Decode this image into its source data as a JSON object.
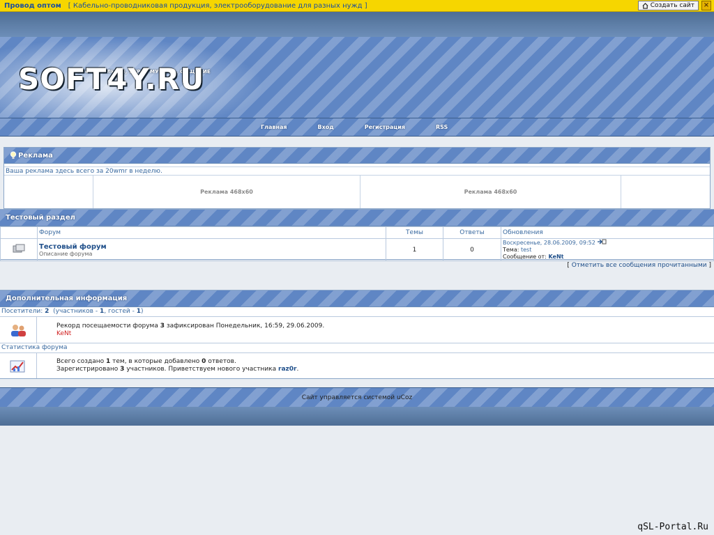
{
  "ad_bar": {
    "title": "Провод оптом",
    "description": "[ Кабельно-проводниковая продукция, электрооборудование для разных нужд ]",
    "create_site_label": "Создать сайт",
    "close_label": "×"
  },
  "header": {
    "logo_text": "SOFT4Y.RU",
    "tagline": "СОФТ, ФИЛЬМЫ, ИГРЫ, МУЗЫКА, ОБЩЕНИЕ"
  },
  "nav": {
    "items": [
      "Главная",
      "Вход",
      "Регистрация",
      "RSS"
    ]
  },
  "ads": {
    "title": "Реклама",
    "note": "Ваша реклама здесь всего за 20wmr в неделю.",
    "banner1": "Реклама 468x60",
    "banner2": "Реклама 468x60"
  },
  "section": {
    "title": "Тестовый раздел",
    "columns": {
      "forum": "Форум",
      "topics": "Темы",
      "replies": "Ответы",
      "updates": "Обновления"
    },
    "forum": {
      "name": "Тестовый форум",
      "description": "Описание форума",
      "topics": "1",
      "replies": "0",
      "last_date": "Воскресенье, 28.06.2009, 09:52",
      "topic_label": "Тема:",
      "topic_name": "test",
      "message_label": "Сообщение от:",
      "message_author": "KeNt"
    }
  },
  "mark_read": {
    "open": "[",
    "label": "Отметить все сообщения прочитанными",
    "close": "]"
  },
  "info": {
    "title": "Дополнительная информация",
    "visitors": {
      "label": "Посетители:",
      "total": "2",
      "members_label": "(участников -",
      "members": "1",
      "guests_label": ", гостей -",
      "guests": "1",
      "close": ")"
    },
    "record": {
      "prefix": "Рекорд посещаемости форума",
      "count": "3",
      "suffix": "зафиксирован Понедельник, 16:59, 29.06.2009.",
      "user": "KeNt"
    },
    "stats_label": "Статистика форума",
    "stats": {
      "l1_a": "Всего создано",
      "topics": "1",
      "l1_b": "тем, в которые добавлено",
      "replies": "0",
      "l1_c": "ответов.",
      "l2_a": "Зарегистрировано",
      "members": "3",
      "l2_b": "участников. Приветствуем нового участника",
      "newest": "raz0r",
      "l2_c": "."
    }
  },
  "footer": {
    "text": "Сайт управляется системой uCoz"
  },
  "watermark": "qSL-Portal.Ru",
  "colors": {
    "ad_bar": "#f6d600",
    "stripe_blue": "#5f86c4",
    "link": "#1f4f8a",
    "highlight_user": "#d02020"
  }
}
